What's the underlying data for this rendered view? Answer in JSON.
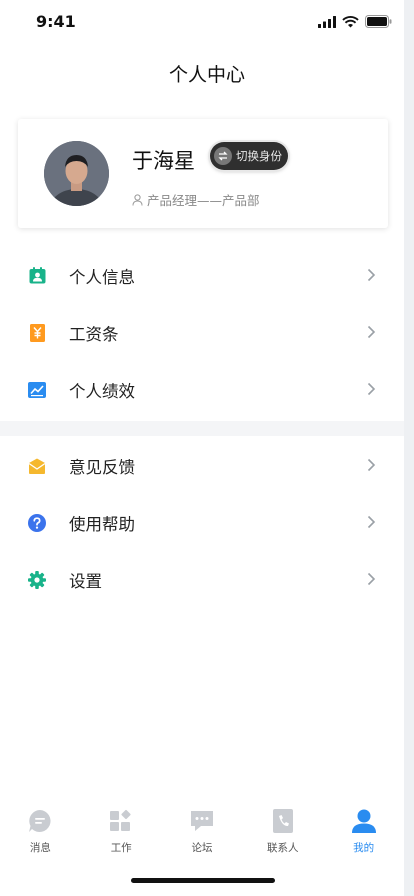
{
  "status_bar": {
    "time": "9:41"
  },
  "nav": {
    "title": "个人中心"
  },
  "profile": {
    "name": "于海星",
    "switch_label": "切换身份",
    "department": "产品经理——产品部"
  },
  "menu_group_1": [
    {
      "label": "个人信息",
      "icon": "id-card-icon",
      "color": "#19b38a"
    },
    {
      "label": "工资条",
      "icon": "salary-icon",
      "color": "#ff9a1f"
    },
    {
      "label": "个人绩效",
      "icon": "performance-chart-icon",
      "color": "#2a8cf0"
    }
  ],
  "menu_group_2": [
    {
      "label": "意见反馈",
      "icon": "feedback-mail-icon",
      "color": "#f5b82e"
    },
    {
      "label": "使用帮助",
      "icon": "help-icon",
      "color": "#3b73ec"
    },
    {
      "label": "设置",
      "icon": "settings-gear-icon",
      "color": "#19b38a"
    }
  ],
  "tabs": [
    {
      "label": "消息",
      "icon": "message-icon",
      "active": false
    },
    {
      "label": "工作",
      "icon": "work-grid-icon",
      "active": false
    },
    {
      "label": "论坛",
      "icon": "forum-icon",
      "active": false
    },
    {
      "label": "联系人",
      "icon": "contacts-icon",
      "active": false
    },
    {
      "label": "我的",
      "icon": "profile-icon",
      "active": true
    }
  ],
  "colors": {
    "accent": "#2a8cf0",
    "inactive_icon": "#c9ccd1"
  }
}
